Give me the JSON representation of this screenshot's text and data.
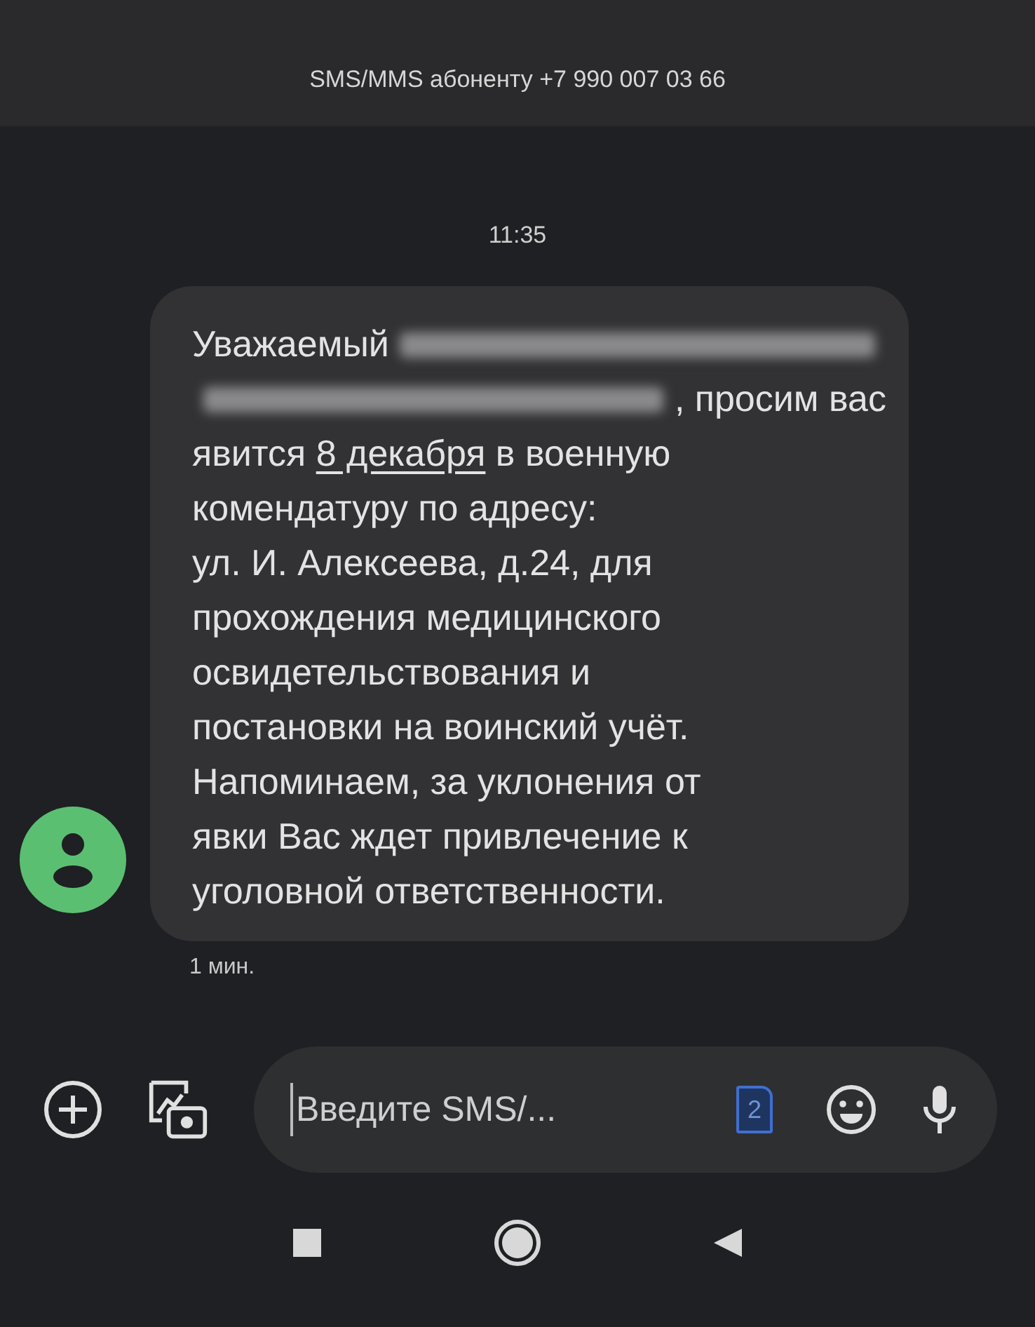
{
  "header": {
    "title": "SMS/MMS абоненту +7 990 007 03 66"
  },
  "conversation": {
    "time": "11:35",
    "message": {
      "lines": [
        [
          {
            "kind": "text",
            "text": "Уважаемый"
          },
          {
            "kind": "redacted"
          }
        ],
        [
          {
            "kind": "redacted"
          },
          {
            "kind": "text",
            "text": ", просим вас"
          }
        ],
        [
          {
            "kind": "text",
            "text": "явится "
          },
          {
            "kind": "link",
            "text": "8 декабря"
          },
          {
            "kind": "text",
            "text": " в военную"
          }
        ],
        [
          {
            "kind": "text",
            "text": "комендатуру по адресу:"
          }
        ],
        [
          {
            "kind": "text",
            "text": "ул. И. Алексеева, д.24, для"
          }
        ],
        [
          {
            "kind": "text",
            "text": "прохождения медицинского"
          }
        ],
        [
          {
            "kind": "text",
            "text": "освидетельствования и"
          }
        ],
        [
          {
            "kind": "text",
            "text": "постановки на воинский учёт."
          }
        ],
        [
          {
            "kind": "text",
            "text": "Напоминаем, за уклонения от"
          }
        ],
        [
          {
            "kind": "text",
            "text": "явки Вас ждет привлечение к"
          }
        ],
        [
          {
            "kind": "text",
            "text": "уголовной ответственности."
          }
        ]
      ],
      "age": "1 мин."
    }
  },
  "composer": {
    "placeholder": "Введите SMS/...",
    "sim_slot": "2"
  }
}
